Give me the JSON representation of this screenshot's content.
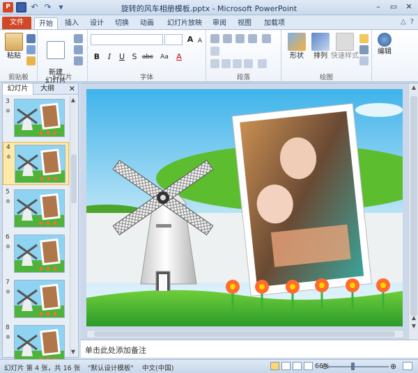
{
  "titlebar": {
    "title": "旋转的风车相册模板.pptx - Microsoft PowerPoint",
    "app_icon_letter": "P"
  },
  "tabs": {
    "file": "文件",
    "items": [
      "开始",
      "插入",
      "设计",
      "切换",
      "动画",
      "幻灯片放映",
      "审阅",
      "视图",
      "加载项"
    ]
  },
  "ribbon": {
    "clipboard": {
      "paste": "粘贴",
      "title": "剪贴板"
    },
    "slides": {
      "new_slide": "新建\n幻灯片",
      "title": "幻灯片"
    },
    "font": {
      "title": "字体",
      "bold": "B",
      "italic": "I",
      "underline": "U",
      "strike": "S",
      "spacing": "abc",
      "size_up": "A",
      "size_down": "A",
      "case": "Aa",
      "font_color": "A"
    },
    "paragraph": {
      "title": "段落"
    },
    "drawing": {
      "shape": "形状",
      "arrange": "排列",
      "quick_styles": "快速样式",
      "title": "绘图"
    },
    "editing": {
      "label": "编辑"
    }
  },
  "left_panel": {
    "tab_slides": "幻灯片",
    "tab_outline": "大纲",
    "thumbs": [
      {
        "num": "3",
        "selected": false
      },
      {
        "num": "4",
        "selected": true
      },
      {
        "num": "5",
        "selected": false
      },
      {
        "num": "6",
        "selected": false
      },
      {
        "num": "7",
        "selected": false
      },
      {
        "num": "8",
        "selected": false
      }
    ]
  },
  "notes": {
    "placeholder": "单击此处添加备注"
  },
  "status": {
    "slide_info": "幻灯片 第 4 张，共 16 张",
    "theme": "\"默认设计模板\"",
    "language": "中文(中国)",
    "zoom": "66%",
    "zoom_level": 0.66
  },
  "colors": {
    "accent": "#d24726",
    "sky": "#6cc6ee",
    "grass": "#34a832"
  }
}
